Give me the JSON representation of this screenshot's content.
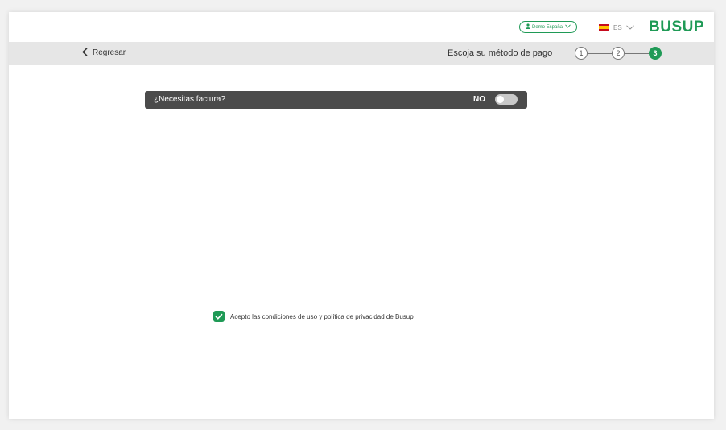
{
  "header": {
    "user_label": "Demo España",
    "lang_code": "ES",
    "logo": "BUSUP",
    "brand_color": "#1f9a56"
  },
  "subbar": {
    "back_label": "Regresar",
    "step_title": "Escoja su método de pago",
    "steps": [
      "1",
      "2",
      "3"
    ],
    "current_step": 3
  },
  "invoice": {
    "question": "¿Necesitas factura?",
    "state_label": "NO",
    "enabled": false
  },
  "terms": {
    "text": "Acepto las condiciones de uso y política de privacidad de Busup",
    "checked": true
  }
}
